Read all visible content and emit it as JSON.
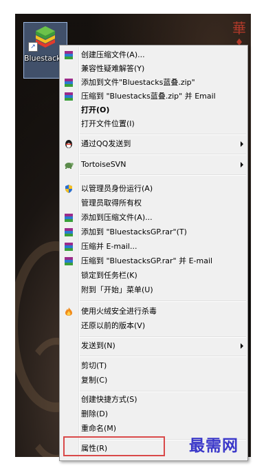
{
  "desktop_icon": {
    "label": "Bluestacks蓝叠",
    "image": "bluestacks-logo-icon",
    "shortcut_overlay": "shortcut-arrow-icon"
  },
  "menu_items": {
    "create_archive": "创建压缩文件(A)...",
    "compat_troubleshoot": "兼容性疑难解答(Y)",
    "add_to_zip": "添加到文件\"Bluestacks蓝叠.zip\"",
    "zip_and_email": "压缩到 \"Bluestacks蓝叠.zip\" 并 Email",
    "open": "打开(O)",
    "open_location": "打开文件位置(I)",
    "send_via_qq": "通过QQ发送到",
    "tortoisesvn": "TortoiseSVN",
    "run_as_admin": "以管理员身份运行(A)",
    "take_ownership": "管理员取得所有权",
    "add_to_archive": "添加到压缩文件(A)...",
    "add_to_rar": "添加到 \"BluestacksGP.rar\"(T)",
    "compress_email": "压缩并 E-mail...",
    "rar_and_email": "压缩到 \"BluestacksGP.rar\" 并 E-mail",
    "pin_taskbar": "锁定到任务栏(K)",
    "pin_start": "附到「开始」菜单(U)",
    "scan_huorong": "使用火绒安全进行杀毒",
    "restore_previous": "还原以前的版本(V)",
    "send_to": "发送到(N)",
    "cut": "剪切(T)",
    "copy": "复制(C)",
    "create_shortcut": "创建快捷方式(S)",
    "delete": "删除(D)",
    "rename": "重命名(M)",
    "properties": "属性(R)"
  },
  "icons": {
    "winrar": "winrar-books-icon",
    "qq": "qq-penguin-icon",
    "tortoisesvn": "tortoisesvn-icon",
    "uac_shield": "uac-shield-icon",
    "huorong": "huorong-flame-icon"
  },
  "watermark": "最需网",
  "highlight_color": "#d94848",
  "deco_marks": [
    "華",
    "♦"
  ]
}
